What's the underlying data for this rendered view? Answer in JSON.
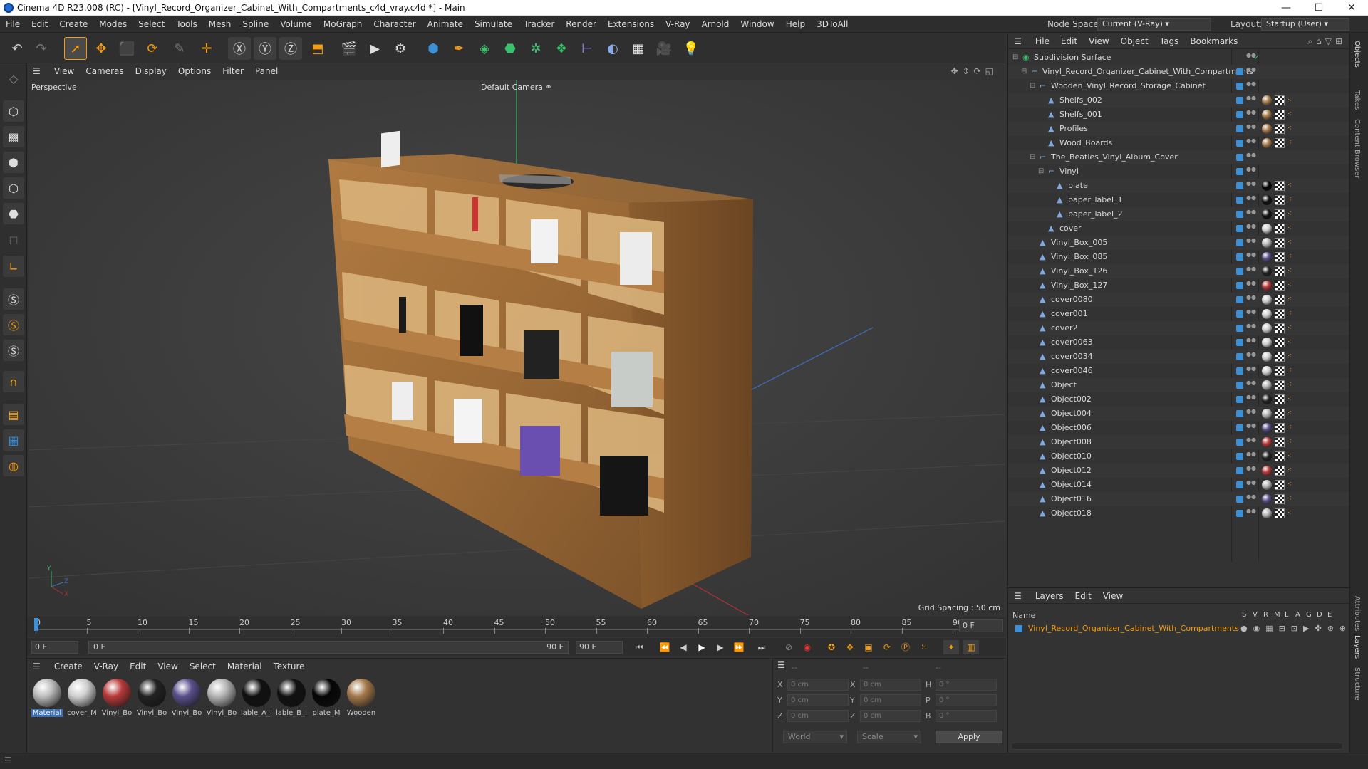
{
  "window": {
    "title": "Cinema 4D R23.008 (RC) - [Vinyl_Record_Organizer_Cabinet_With_Compartments_c4d_vray.c4d *] - Main",
    "min": "—",
    "max": "☐",
    "close": "✕"
  },
  "menu": [
    "File",
    "Edit",
    "Create",
    "Modes",
    "Select",
    "Tools",
    "Mesh",
    "Spline",
    "Volume",
    "MoGraph",
    "Character",
    "Animate",
    "Simulate",
    "Tracker",
    "Render",
    "Extensions",
    "V-Ray",
    "Arnold",
    "Window",
    "Help",
    "3DToAll"
  ],
  "node_space": {
    "label": "Node Space:",
    "value": "Current (V-Ray)"
  },
  "layout": {
    "label": "Layout:",
    "value": "Startup (User)"
  },
  "viewport": {
    "menu": [
      "View",
      "Cameras",
      "Display",
      "Options",
      "Filter",
      "Panel"
    ],
    "name": "Perspective",
    "camera": "Default Camera",
    "grid_spacing": "Grid Spacing : 50 cm",
    "axis_y": "Y",
    "axis_z": "Z",
    "axis_x": "X"
  },
  "timeline": {
    "ticks": [
      "0",
      "5",
      "10",
      "15",
      "20",
      "25",
      "30",
      "35",
      "40",
      "45",
      "50",
      "55",
      "60",
      "65",
      "70",
      "75",
      "80",
      "85",
      "90"
    ],
    "current": "0 F"
  },
  "transport": {
    "start": "0 F",
    "range_start": "0 F",
    "range_end": "90 F",
    "end": "90 F"
  },
  "materials": {
    "menu": [
      "Create",
      "V-Ray",
      "Edit",
      "View",
      "Select",
      "Material",
      "Texture"
    ],
    "items": [
      {
        "label": "Material",
        "color": "#bdbdbd"
      },
      {
        "label": "cover_M",
        "color": "#d0d0d0"
      },
      {
        "label": "Vinyl_Bo",
        "color": "#b83a3a"
      },
      {
        "label": "Vinyl_Bo",
        "color": "#222222"
      },
      {
        "label": "Vinyl_Bo",
        "color": "#5a4f8a"
      },
      {
        "label": "Vinyl_Bo",
        "color": "#b5b5b5"
      },
      {
        "label": "lable_A_I",
        "color": "#111111"
      },
      {
        "label": "lable_B_I",
        "color": "#111111"
      },
      {
        "label": "plate_M",
        "color": "#050505"
      },
      {
        "label": "Wooden",
        "color": "#a5794c"
      }
    ]
  },
  "coords": {
    "headers": [
      "--",
      "--",
      "--"
    ],
    "rows": [
      {
        "a": "X",
        "av": "0 cm",
        "b": "X",
        "bv": "0 cm",
        "c": "H",
        "cv": "0 °"
      },
      {
        "a": "Y",
        "av": "0 cm",
        "b": "Y",
        "bv": "0 cm",
        "c": "P",
        "cv": "0 °"
      },
      {
        "a": "Z",
        "av": "0 cm",
        "b": "Z",
        "bv": "0 cm",
        "c": "B",
        "cv": "0 °"
      }
    ],
    "mode": "World",
    "scale": "Scale",
    "apply": "Apply"
  },
  "objects": {
    "menu": [
      "File",
      "Edit",
      "View",
      "Object",
      "Tags",
      "Bookmarks"
    ],
    "tree": [
      {
        "name": "Subdivision Surface",
        "depth": 0,
        "mat": ""
      },
      {
        "name": "Vinyl_Record_Organizer_Cabinet_With_Compartments",
        "depth": 1,
        "mat": ""
      },
      {
        "name": "Wooden_Vinyl_Record_Storage_Cabinet",
        "depth": 2,
        "mat": ""
      },
      {
        "name": "Shelfs_002",
        "depth": 3,
        "mat": "#a5794c"
      },
      {
        "name": "Shelfs_001",
        "depth": 3,
        "mat": "#a5794c"
      },
      {
        "name": "Profiles",
        "depth": 3,
        "mat": "#a5794c"
      },
      {
        "name": "Wood_Boards",
        "depth": 3,
        "mat": "#a5794c"
      },
      {
        "name": "The_Beatles_Vinyl_Album_Cover",
        "depth": 2,
        "mat": ""
      },
      {
        "name": "Vinyl",
        "depth": 3,
        "mat": ""
      },
      {
        "name": "plate",
        "depth": 4,
        "mat": "#050505"
      },
      {
        "name": "paper_label_1",
        "depth": 4,
        "mat": "#111111"
      },
      {
        "name": "paper_label_2",
        "depth": 4,
        "mat": "#111111"
      },
      {
        "name": "cover",
        "depth": 3,
        "mat": "#cfcfcf"
      },
      {
        "name": "Vinyl_Box_005",
        "depth": 2,
        "mat": "#b5b5b5"
      },
      {
        "name": "Vinyl_Box_085",
        "depth": 2,
        "mat": "#5a4f8a"
      },
      {
        "name": "Vinyl_Box_126",
        "depth": 2,
        "mat": "#222222"
      },
      {
        "name": "Vinyl_Box_127",
        "depth": 2,
        "mat": "#b83a3a"
      },
      {
        "name": "cover0080",
        "depth": 2,
        "mat": "#cfcfcf"
      },
      {
        "name": "cover001",
        "depth": 2,
        "mat": "#cfcfcf"
      },
      {
        "name": "cover2",
        "depth": 2,
        "mat": "#cfcfcf"
      },
      {
        "name": "cover0063",
        "depth": 2,
        "mat": "#cfcfcf"
      },
      {
        "name": "cover0034",
        "depth": 2,
        "mat": "#cfcfcf"
      },
      {
        "name": "cover0046",
        "depth": 2,
        "mat": "#cfcfcf"
      },
      {
        "name": "Object",
        "depth": 2,
        "mat": "#b5b5b5"
      },
      {
        "name": "Object002",
        "depth": 2,
        "mat": "#222222"
      },
      {
        "name": "Object004",
        "depth": 2,
        "mat": "#b5b5b5"
      },
      {
        "name": "Object006",
        "depth": 2,
        "mat": "#5a4f8a"
      },
      {
        "name": "Object008",
        "depth": 2,
        "mat": "#b83a3a"
      },
      {
        "name": "Object010",
        "depth": 2,
        "mat": "#222222"
      },
      {
        "name": "Object012",
        "depth": 2,
        "mat": "#b83a3a"
      },
      {
        "name": "Object014",
        "depth": 2,
        "mat": "#b5b5b5"
      },
      {
        "name": "Object016",
        "depth": 2,
        "mat": "#5a4f8a"
      },
      {
        "name": "Object018",
        "depth": 2,
        "mat": "#b5b5b5"
      }
    ]
  },
  "layers": {
    "menu": [
      "Layers",
      "Edit",
      "View"
    ],
    "col_name": "Name",
    "cols": [
      "S",
      "V",
      "R",
      "M",
      "L",
      "A",
      "G",
      "D",
      "E"
    ],
    "row": "Vinyl_Record_Organizer_Cabinet_With_Compartments",
    "accent": "#f39c12"
  },
  "side_tabs": [
    "Objects",
    "Takes",
    "Content Browser",
    "Attributes",
    "Layers",
    "Structure"
  ]
}
